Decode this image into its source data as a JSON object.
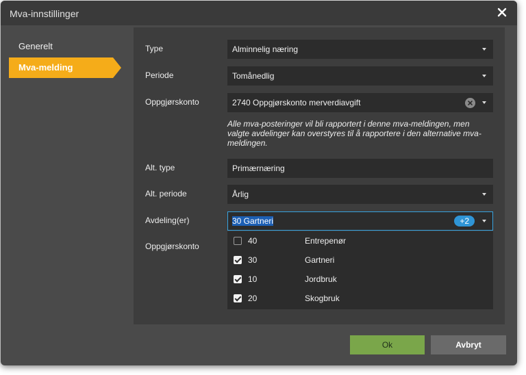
{
  "dialog": {
    "title": "Mva-innstillinger"
  },
  "sidebar": {
    "items": [
      {
        "label": "Generelt",
        "active": false
      },
      {
        "label": "Mva-melding",
        "active": true
      }
    ]
  },
  "form": {
    "type": {
      "label": "Type",
      "value": "Alminnelig næring"
    },
    "periode": {
      "label": "Periode",
      "value": "Tomånedlig"
    },
    "oppgjorskonto": {
      "label": "Oppgjørskonto",
      "value": "2740 Oppgjørskonto merverdiavgift"
    },
    "note": "Alle mva-posteringer vil bli rapportert i denne mva-meldingen, men valgte avdelinger kan overstyres til å rapportere i den alternative mva-meldingen.",
    "alt_type": {
      "label": "Alt. type",
      "value": "Primærnæring"
    },
    "alt_periode": {
      "label": "Alt. periode",
      "value": "Årlig"
    },
    "avdelinger": {
      "label": "Avdeling(er)",
      "value": "30 Gartneri",
      "extra_count": "+2"
    },
    "alt_oppgjorskonto": {
      "label": "Oppgjørskonto"
    }
  },
  "dropdown": {
    "options": [
      {
        "code": "40",
        "name": "Entrepenør",
        "checked": false
      },
      {
        "code": "30",
        "name": "Gartneri",
        "checked": true
      },
      {
        "code": "10",
        "name": "Jordbruk",
        "checked": true
      },
      {
        "code": "20",
        "name": "Skogbruk",
        "checked": true
      }
    ]
  },
  "buttons": {
    "ok": "Ok",
    "cancel": "Avbryt"
  },
  "colors": {
    "accent": "#f5ac19",
    "focus": "#37a3e0",
    "ok_button": "#7aa64a"
  }
}
